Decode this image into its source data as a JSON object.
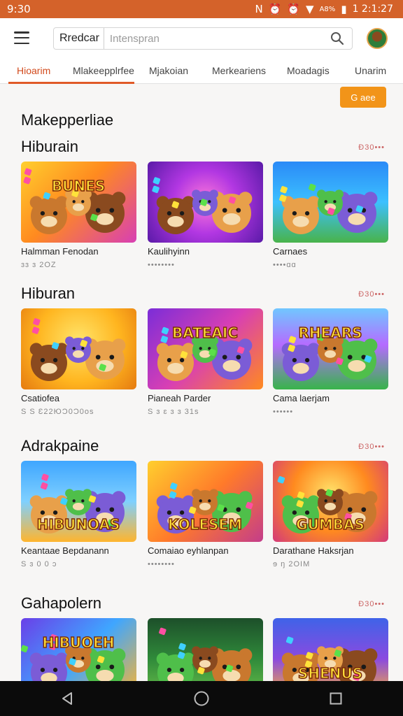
{
  "status_bar": {
    "time": "9:30",
    "carrier_text": "A8%",
    "clock": "1 2:1:27"
  },
  "header": {
    "search_tag": "Rredcar",
    "search_placeholder": "Intenspran"
  },
  "tabs": [
    {
      "label": "Hioarim",
      "active": true
    },
    {
      "label": "Mlakeepplrfee",
      "active": false
    },
    {
      "label": "Mjakoian",
      "active": false
    },
    {
      "label": "Merkeariens",
      "active": false
    },
    {
      "label": "Moadagis",
      "active": false
    },
    {
      "label": "Unarim",
      "active": false
    }
  ],
  "action_button": {
    "label": "G aee"
  },
  "page_title": "Makepperliae",
  "sections": [
    {
      "title": "Hiburain",
      "see_more": "Ð30•••",
      "cards": [
        {
          "title": "Halmman Fenodan",
          "meta": "ɜɜ ɜ 2OZ",
          "art": "bunes",
          "badge": "BUNES"
        },
        {
          "title": "Kaulihyinn",
          "meta": "••••••••",
          "art": "purple",
          "badge": ""
        },
        {
          "title": "Carnaes",
          "meta": "••••ɑɑ",
          "art": "blue",
          "badge": ""
        }
      ]
    },
    {
      "title": "Hiburan",
      "see_more": "Ð30•••",
      "cards": [
        {
          "title": "Csatiofea",
          "meta": "S S Ɛ22ЮƆ0Ɔ0os",
          "art": "bear-box",
          "badge": ""
        },
        {
          "title": "Pianeah Parder",
          "meta": "S ɜ ɛ ɜ ɜ 31s",
          "art": "bateaic",
          "badge": "BATEAIC"
        },
        {
          "title": "Cama laerjam",
          "meta": "••••••",
          "art": "rhears",
          "badge": "RHEARS"
        }
      ]
    },
    {
      "title": "Adrakpaine",
      "see_more": "Ð30•••",
      "cards": [
        {
          "title": "Keantaae Bepdanann",
          "meta": "S ɜ 0 0 ɔ",
          "art": "hibunoas",
          "badge": "HIBUNOAS"
        },
        {
          "title": "Comaiao eyhlanpan",
          "meta": "••••••••",
          "art": "kolesem",
          "badge": "KOLESEM"
        },
        {
          "title": "Darathane Haksrjan",
          "meta": "ɘ ŋ 2OIM",
          "art": "gumbas",
          "badge": "GUMBAS"
        }
      ]
    },
    {
      "title": "Gahapolern",
      "see_more": "Ð30•••",
      "cards": [
        {
          "title": "",
          "meta": "",
          "art": "hibuoeh",
          "badge": "HIBUOEH"
        },
        {
          "title": "",
          "meta": "",
          "art": "green-bears",
          "badge": ""
        },
        {
          "title": "",
          "meta": "",
          "art": "shenus",
          "badge": "SHENUS"
        }
      ]
    }
  ],
  "colors": {
    "status_bar": "#d4622a",
    "accent": "#e05a27",
    "action_button": "#f29419"
  },
  "icons": {
    "menu": "hamburger-icon",
    "search": "search-icon",
    "nav": [
      "back-icon",
      "home-icon",
      "recents-icon"
    ]
  }
}
